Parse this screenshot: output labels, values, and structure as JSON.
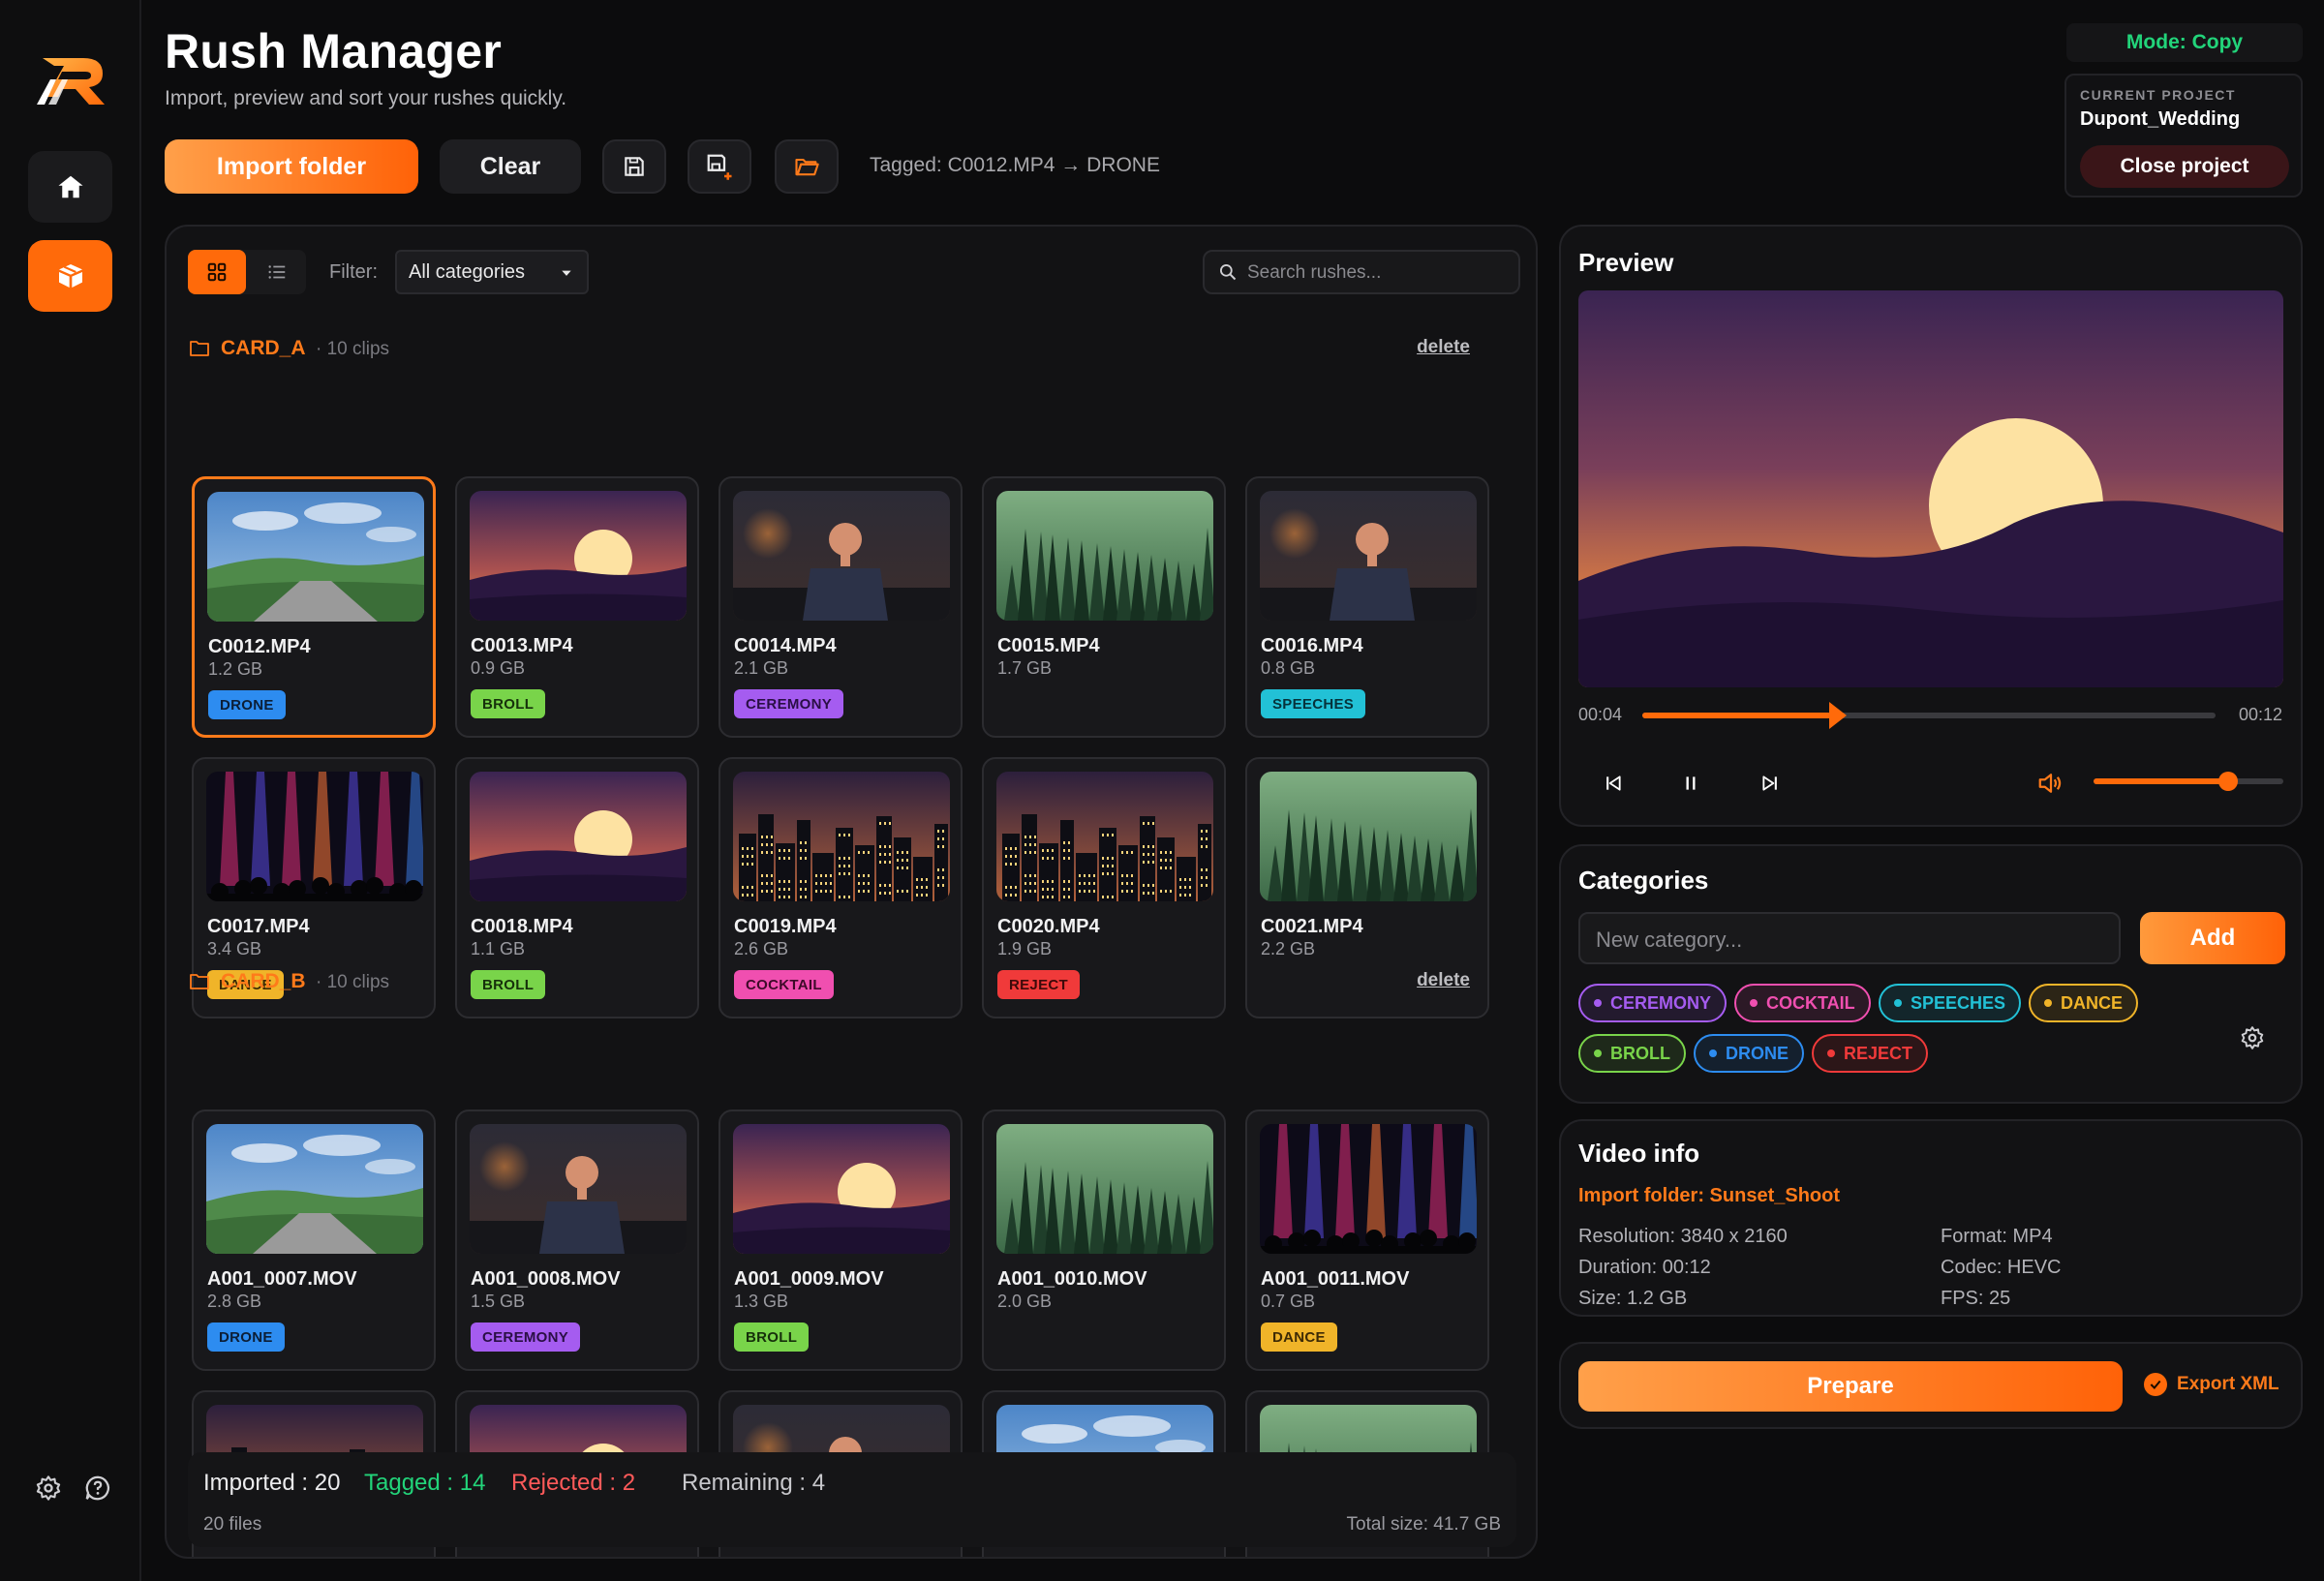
{
  "app": {
    "title": "Rush Manager",
    "subtitle": "Import, preview and sort your rushes quickly."
  },
  "toolbar": {
    "import_label": "Import folder",
    "clear_label": "Clear",
    "tagged_status": "Tagged: C0012.MP4 → DRONE"
  },
  "mode": "Mode: Copy",
  "project": {
    "label": "CURRENT PROJECT",
    "name": "Dupont_Wedding",
    "close_label": "Close project"
  },
  "browser": {
    "filter_label": "Filter:",
    "filter_value": "All categories",
    "search_placeholder": "Search rushes..."
  },
  "folders": [
    {
      "name": "CARD_A",
      "count": "· 10 clips",
      "delete_label": "delete",
      "clips": [
        {
          "name": "C0012.MP4",
          "size": "1.2 GB",
          "tag": "DRONE",
          "thumb": "road",
          "selected": true
        },
        {
          "name": "C0013.MP4",
          "size": "0.9 GB",
          "tag": "BROLL",
          "thumb": "sunset"
        },
        {
          "name": "C0014.MP4",
          "size": "2.1 GB",
          "tag": "CEREMONY",
          "thumb": "person"
        },
        {
          "name": "C0015.MP4",
          "size": "1.7 GB",
          "tag": "",
          "thumb": "forest"
        },
        {
          "name": "C0016.MP4",
          "size": "0.8 GB",
          "tag": "SPEECHES",
          "thumb": "person"
        },
        {
          "name": "C0017.MP4",
          "size": "3.4 GB",
          "tag": "DANCE",
          "thumb": "concert"
        },
        {
          "name": "C0018.MP4",
          "size": "1.1 GB",
          "tag": "BROLL",
          "thumb": "sunset"
        },
        {
          "name": "C0019.MP4",
          "size": "2.6 GB",
          "tag": "COCKTAIL",
          "thumb": "city"
        },
        {
          "name": "C0020.MP4",
          "size": "1.9 GB",
          "tag": "REJECT",
          "thumb": "city"
        },
        {
          "name": "C0021.MP4",
          "size": "2.2 GB",
          "tag": "",
          "thumb": "forest"
        }
      ]
    },
    {
      "name": "CARD_B",
      "count": "· 10 clips",
      "delete_label": "delete",
      "clips": [
        {
          "name": "A001_0007.MOV",
          "size": "2.8 GB",
          "tag": "DRONE",
          "thumb": "road"
        },
        {
          "name": "A001_0008.MOV",
          "size": "1.5 GB",
          "tag": "CEREMONY",
          "thumb": "person"
        },
        {
          "name": "A001_0009.MOV",
          "size": "1.3 GB",
          "tag": "BROLL",
          "thumb": "sunset"
        },
        {
          "name": "A001_0010.MOV",
          "size": "2.0 GB",
          "tag": "",
          "thumb": "forest"
        },
        {
          "name": "A001_0011.MOV",
          "size": "0.7 GB",
          "tag": "DANCE",
          "thumb": "concert"
        },
        {
          "name": "",
          "size": "",
          "tag": "",
          "thumb": "city"
        },
        {
          "name": "",
          "size": "",
          "tag": "",
          "thumb": "sunset"
        },
        {
          "name": "",
          "size": "",
          "tag": "",
          "thumb": "person"
        },
        {
          "name": "",
          "size": "",
          "tag": "",
          "thumb": "road"
        },
        {
          "name": "",
          "size": "",
          "tag": "",
          "thumb": "forest"
        }
      ]
    }
  ],
  "stats": {
    "imported": "Imported : 20",
    "tagged": "Tagged : 14",
    "rejected": "Rejected : 2",
    "remaining": "Remaining : 4",
    "files": "20 files",
    "total_size": "Total size: 41.7 GB"
  },
  "preview": {
    "title": "Preview",
    "current_time": "00:04",
    "total_time": "00:12",
    "progress": 0.33,
    "volume": 0.71
  },
  "categories": {
    "title": "Categories",
    "input_placeholder": "New category...",
    "add_label": "Add",
    "items": [
      "CEREMONY",
      "COCKTAIL",
      "SPEECHES",
      "DANCE",
      "BROLL",
      "DRONE",
      "REJECT"
    ]
  },
  "tag_colors": {
    "DRONE": {
      "bg": "#2d8cf0",
      "fg": "#0c1e36"
    },
    "BROLL": {
      "bg": "#79d44a",
      "fg": "#16300b"
    },
    "CEREMONY": {
      "bg": "#a55cf0",
      "fg": "#2a0f45"
    },
    "SPEECHES": {
      "bg": "#22c1d6",
      "fg": "#06323a"
    },
    "DANCE": {
      "bg": "#f0b429",
      "fg": "#3d2a05"
    },
    "COCKTAIL": {
      "bg": "#f04fb0",
      "fg": "#3e0a29"
    },
    "REJECT": {
      "bg": "#f03a3a",
      "fg": "#3e0a0a"
    }
  },
  "chip_colors": {
    "CEREMONY": "#a55cf0",
    "COCKTAIL": "#f04fb0",
    "SPEECHES": "#22c1d6",
    "DANCE": "#f0b429",
    "BROLL": "#79d44a",
    "DRONE": "#2d8cf0",
    "REJECT": "#f03a3a"
  },
  "video_info": {
    "title": "Video info",
    "import_folder": "Import folder: Sunset_Shoot",
    "resolution": "Resolution: 3840 x 2160",
    "duration": "Duration: 00:12",
    "size": "Size: 1.2 GB",
    "format": "Format: MP4",
    "codec": "Codec: HEVC",
    "fps": "FPS: 25"
  },
  "actions": {
    "prepare_label": "Prepare",
    "export_label": "Export XML"
  }
}
